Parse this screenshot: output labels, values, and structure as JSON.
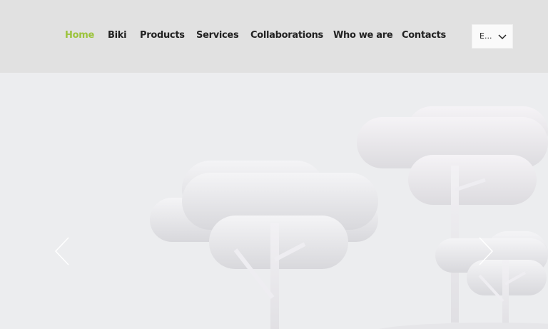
{
  "nav": {
    "items": [
      {
        "label": "Home",
        "active": true
      },
      {
        "label": "Biki",
        "active": false
      },
      {
        "label": "Products",
        "active": false
      },
      {
        "label": "Services",
        "active": false
      },
      {
        "label": "Collaborations",
        "active": false
      },
      {
        "label": "Who we are",
        "active": false
      },
      {
        "label": "Contacts",
        "active": false
      }
    ],
    "active_color": "#9bc33b"
  },
  "language": {
    "value": "E..."
  },
  "slider": {
    "prev_icon": "chevron-left-icon",
    "next_icon": "chevron-right-icon"
  },
  "colors": {
    "header_bg": "#e1e1e1",
    "hero_bg": "#ecedef"
  }
}
